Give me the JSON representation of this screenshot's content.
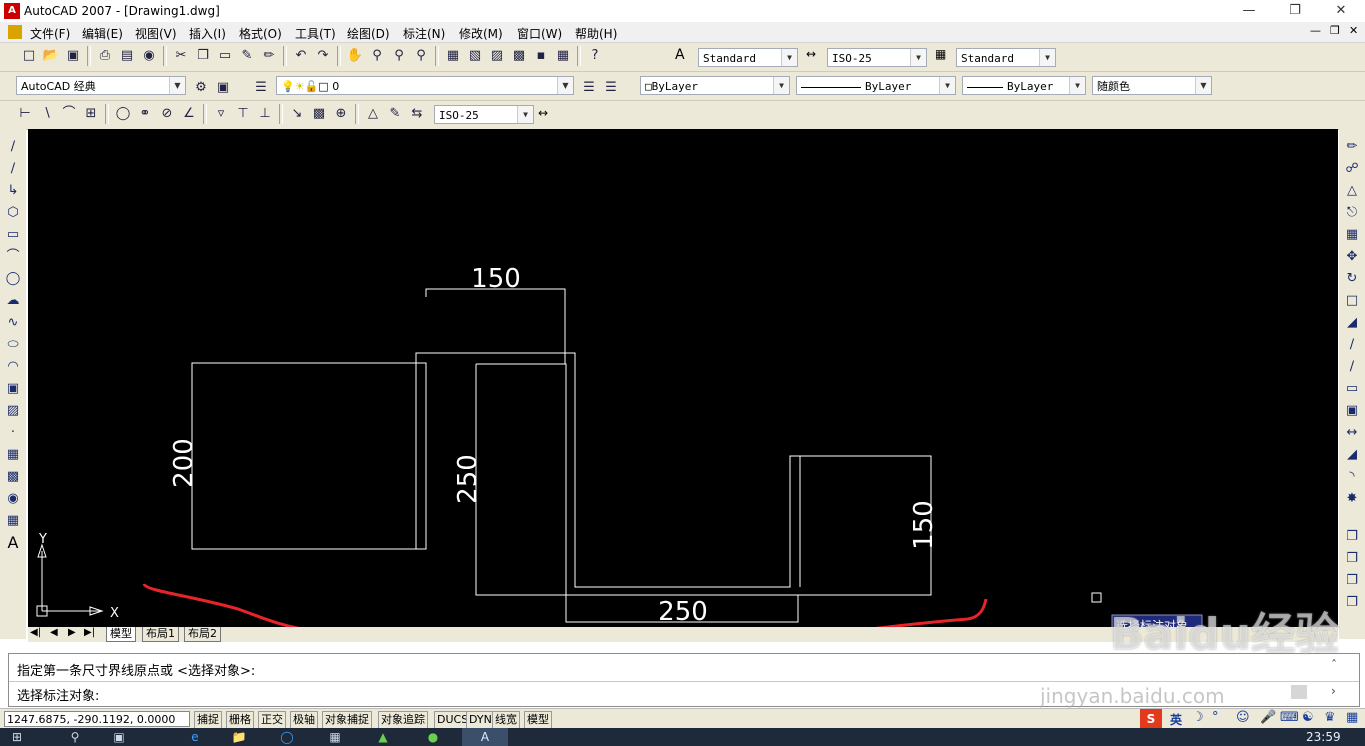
{
  "window": {
    "title": "AutoCAD 2007 - [Drawing1.dwg]",
    "icon_text": "A"
  },
  "menu": [
    "文件(F)",
    "编辑(E)",
    "视图(V)",
    "插入(I)",
    "格式(O)",
    "工具(T)",
    "绘图(D)",
    "标注(N)",
    "修改(M)",
    "窗口(W)",
    "帮助(H)"
  ],
  "toolbar1": {
    "text_style": "Standard",
    "dim_style": "ISO-25",
    "table_style": "Standard"
  },
  "toolbar2": {
    "workspace": "AutoCAD 经典",
    "layer": "0",
    "color": "ByLayer",
    "linetype": "ByLayer",
    "lineweight": "ByLayer",
    "plotstyle": "随颜色"
  },
  "toolbar3": {
    "dim_style": "ISO-25"
  },
  "drawing": {
    "dims": [
      "150",
      "200",
      "250",
      "150",
      "250"
    ],
    "ucs_x": "X",
    "ucs_y": "Y",
    "tooltip": "选择标注对象"
  },
  "tabs": [
    "模型",
    "布局1",
    "布局2"
  ],
  "command": {
    "line1": "指定第一条尺寸界线原点或 <选择对象>:",
    "line2": "选择标注对象:"
  },
  "status": {
    "coords": "1247.6875, -290.1192, 0.0000",
    "buttons": [
      "捕捉",
      "栅格",
      "正交",
      "极轴",
      "对象捕捉",
      "对象追踪",
      "DUCS",
      "DYN",
      "线宽",
      "模型"
    ]
  },
  "taskbar": {
    "ime": "英",
    "time": "23:59"
  },
  "watermark": {
    "text": "Baidu经验",
    "url": "jingyan.baidu.com"
  },
  "colors": {
    "canvas_bg": "#000000",
    "geometry": "#ffffff",
    "annotation": "#e8232a"
  }
}
